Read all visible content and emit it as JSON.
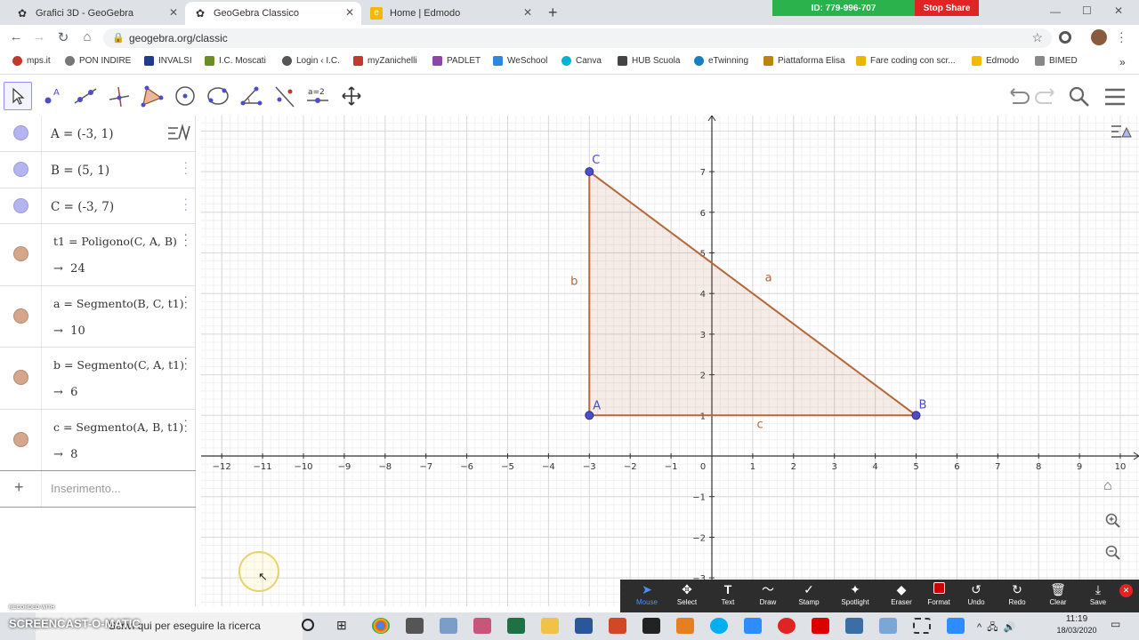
{
  "browser": {
    "tabs": [
      {
        "title": "Grafici 3D - GeoGebra",
        "active": false
      },
      {
        "title": "GeoGebra Classico",
        "active": true
      },
      {
        "title": "Home | Edmodo",
        "active": false
      }
    ],
    "new_tab": "+",
    "url": "geogebra.org/classic",
    "share_id": "ID: 779-996-707",
    "stop_share": "Stop Share",
    "bookmarks": [
      "mps.it",
      "PON INDIRE",
      "INVALSI",
      "I.C. Moscati",
      "Login ‹ I.C.",
      "myZanichelli",
      "PADLET",
      "WeSchool",
      "Canva",
      "HUB Scuola",
      "eTwinning",
      "Piattaforma Elisa",
      "Fare coding con scr...",
      "Edmodo",
      "BIMED"
    ],
    "bookmarks_more": "»"
  },
  "algebra": {
    "rows": [
      {
        "def": "A = (-3, 1)",
        "color": "#b4b4f0"
      },
      {
        "def": "B = (5, 1)",
        "color": "#b4b4f0"
      },
      {
        "def": "C = (-3, 7)",
        "color": "#b4b4f0"
      },
      {
        "def": "t1 = Poligono(C, A, B)",
        "value": "24",
        "color": "#d4a68c"
      },
      {
        "def": "a = Segmento(B, C, t1)",
        "value": "10",
        "color": "#d4a68c"
      },
      {
        "def": "b = Segmento(C, A, t1)",
        "value": "6",
        "color": "#d4a68c"
      },
      {
        "def": "c = Segmento(A, B, t1)",
        "value": "8",
        "color": "#d4a68c"
      }
    ],
    "value_arrow": "→",
    "input_placeholder": "Inserimento...",
    "add_icon": "+"
  },
  "graphics": {
    "x_ticks": [
      "−12",
      "−11",
      "−10",
      "−9",
      "−8",
      "−7",
      "−6",
      "−5",
      "−4",
      "−3",
      "−2",
      "−1",
      "0",
      "1",
      "2",
      "3",
      "4",
      "5",
      "6",
      "7",
      "8",
      "9",
      "10"
    ],
    "y_ticks": [
      "7",
      "6",
      "5",
      "4",
      "3",
      "2",
      "1",
      "−1",
      "−2",
      "−3"
    ],
    "points": [
      {
        "name": "A",
        "x": -3,
        "y": 1
      },
      {
        "name": "B",
        "x": 5,
        "y": 1
      },
      {
        "name": "C",
        "x": -3,
        "y": 7
      }
    ],
    "segment_labels": [
      "a",
      "b",
      "c"
    ],
    "point_color": "#4d4dcc",
    "polygon_color": "#b5663c"
  },
  "zoom_toolbar": {
    "tools": [
      "Mouse",
      "Select",
      "Text",
      "Draw",
      "Stamp",
      "Spotlight",
      "Eraser",
      "Format",
      "Undo",
      "Redo",
      "Clear",
      "Save"
    ]
  },
  "taskbar": {
    "search_placeholder": "Scrivi qui per eseguire la ricerca",
    "time": "11:19",
    "date": "18/03/2020",
    "watermark_top": "RECORDED WITH",
    "watermark": "SCREENCAST-O-MATIC"
  }
}
